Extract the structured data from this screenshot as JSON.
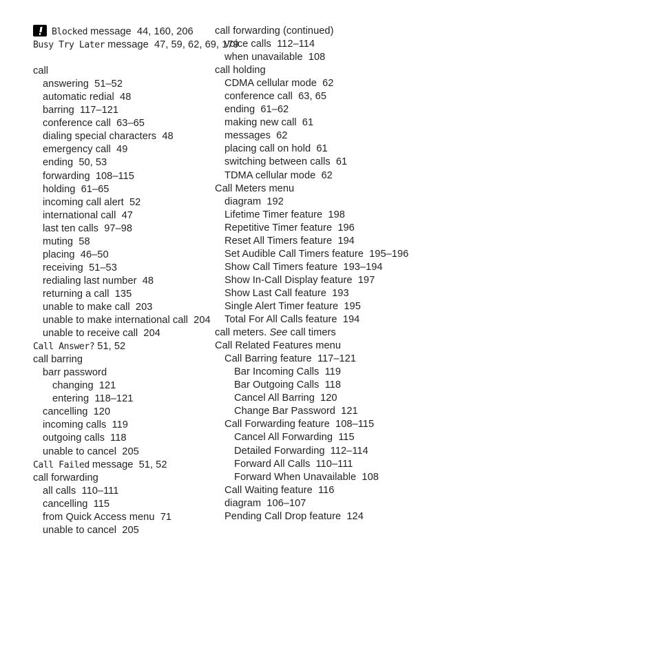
{
  "document": {
    "type": "index",
    "text_color": "#231f20",
    "background_color": "#ffffff",
    "columns": 2
  },
  "left_column": {
    "entries": [
      {
        "level": 0,
        "icon": "alert-exclamation-icon",
        "lcd_text": "Blocked",
        "text": " message  44, 160, 206"
      },
      {
        "level": 0,
        "lcd_text": "Busy Try Later",
        "text": " message  47, 59, 62, 69, 179"
      },
      {
        "level": 0,
        "spacer": true,
        "text": ""
      },
      {
        "level": 0,
        "text": "call"
      },
      {
        "level": 1,
        "text": "answering  51–52"
      },
      {
        "level": 1,
        "text": "automatic redial  48"
      },
      {
        "level": 1,
        "text": "barring  117–121"
      },
      {
        "level": 1,
        "text": "conference call  63–65"
      },
      {
        "level": 1,
        "text": "dialing special characters  48"
      },
      {
        "level": 1,
        "text": "emergency call  49"
      },
      {
        "level": 1,
        "text": "ending  50, 53"
      },
      {
        "level": 1,
        "text": "forwarding  108–115"
      },
      {
        "level": 1,
        "text": "holding  61–65"
      },
      {
        "level": 1,
        "text": "incoming call alert  52"
      },
      {
        "level": 1,
        "text": "international call  47"
      },
      {
        "level": 1,
        "text": "last ten calls  97–98"
      },
      {
        "level": 1,
        "text": "muting  58"
      },
      {
        "level": 1,
        "text": "placing  46–50"
      },
      {
        "level": 1,
        "text": "receiving  51–53"
      },
      {
        "level": 1,
        "text": "redialing last number  48"
      },
      {
        "level": 1,
        "text": "returning a call  135"
      },
      {
        "level": 1,
        "text": "unable to make call  203"
      },
      {
        "level": 1,
        "text": "unable to make international call  204"
      },
      {
        "level": 1,
        "text": "unable to receive call  204"
      },
      {
        "level": 0,
        "lcd_text": "Call Answer?",
        "text": " 51, 52"
      },
      {
        "level": 0,
        "text": "call barring"
      },
      {
        "level": 1,
        "text": "barr password"
      },
      {
        "level": 2,
        "text": "changing  121"
      },
      {
        "level": 2,
        "text": "entering  118–121"
      },
      {
        "level": 1,
        "text": "cancelling  120"
      },
      {
        "level": 1,
        "text": "incoming calls  119"
      },
      {
        "level": 1,
        "text": "outgoing calls  118"
      },
      {
        "level": 1,
        "text": "unable to cancel  205"
      },
      {
        "level": 0,
        "lcd_text": "Call Failed",
        "text": " message  51, 52"
      },
      {
        "level": 0,
        "text": "call forwarding"
      },
      {
        "level": 1,
        "text": "all calls  110–111"
      },
      {
        "level": 1,
        "text": "cancelling  115"
      },
      {
        "level": 1,
        "text": "from Quick Access menu  71"
      },
      {
        "level": 1,
        "text": "unable to cancel  205"
      }
    ]
  },
  "right_column": {
    "entries": [
      {
        "level": 0,
        "text": "call forwarding (continued)"
      },
      {
        "level": 1,
        "text": "voice calls  112–114"
      },
      {
        "level": 1,
        "text": "when unavailable  108"
      },
      {
        "level": 0,
        "text": "call holding"
      },
      {
        "level": 1,
        "text": "CDMA cellular mode  62"
      },
      {
        "level": 1,
        "text": "conference call  63, 65"
      },
      {
        "level": 1,
        "text": "ending  61–62"
      },
      {
        "level": 1,
        "text": "making new call  61"
      },
      {
        "level": 1,
        "text": "messages  62"
      },
      {
        "level": 1,
        "text": "placing call on hold  61"
      },
      {
        "level": 1,
        "text": "switching between calls  61"
      },
      {
        "level": 1,
        "text": "TDMA cellular mode  62"
      },
      {
        "level": 0,
        "text": "Call Meters menu"
      },
      {
        "level": 1,
        "text": "diagram  192"
      },
      {
        "level": 1,
        "text": "Lifetime Timer feature  198"
      },
      {
        "level": 1,
        "text": "Repetitive Timer feature  196"
      },
      {
        "level": 1,
        "text": "Reset All Timers feature  194"
      },
      {
        "level": 1,
        "text": "Set Audible Call Timers feature  195–196"
      },
      {
        "level": 1,
        "text": "Show Call Timers feature  193–194"
      },
      {
        "level": 1,
        "text": "Show In-Call Display feature  197"
      },
      {
        "level": 1,
        "text": "Show Last Call feature  193"
      },
      {
        "level": 1,
        "text": "Single Alert Timer feature  195"
      },
      {
        "level": 1,
        "text": "Total For All Calls feature  194"
      },
      {
        "level": 0,
        "text": "call meters. ",
        "italic_text": "See",
        "text_after": " call timers"
      },
      {
        "level": 0,
        "text": "Call Related Features menu"
      },
      {
        "level": 1,
        "text": "Call Barring feature  117–121"
      },
      {
        "level": 2,
        "text": "Bar Incoming Calls  119"
      },
      {
        "level": 2,
        "text": "Bar Outgoing Calls  118"
      },
      {
        "level": 2,
        "text": "Cancel All Barring  120"
      },
      {
        "level": 2,
        "text": "Change Bar Password  121"
      },
      {
        "level": 1,
        "text": "Call Forwarding feature  108–115"
      },
      {
        "level": 2,
        "text": "Cancel All Forwarding  115"
      },
      {
        "level": 2,
        "text": "Detailed Forwarding  112–114"
      },
      {
        "level": 2,
        "text": "Forward All Calls  110–111"
      },
      {
        "level": 2,
        "text": "Forward When Unavailable  108"
      },
      {
        "level": 1,
        "text": "Call Waiting feature  116"
      },
      {
        "level": 1,
        "text": "diagram  106–107"
      },
      {
        "level": 1,
        "text": "Pending Call Drop feature  124"
      }
    ]
  }
}
